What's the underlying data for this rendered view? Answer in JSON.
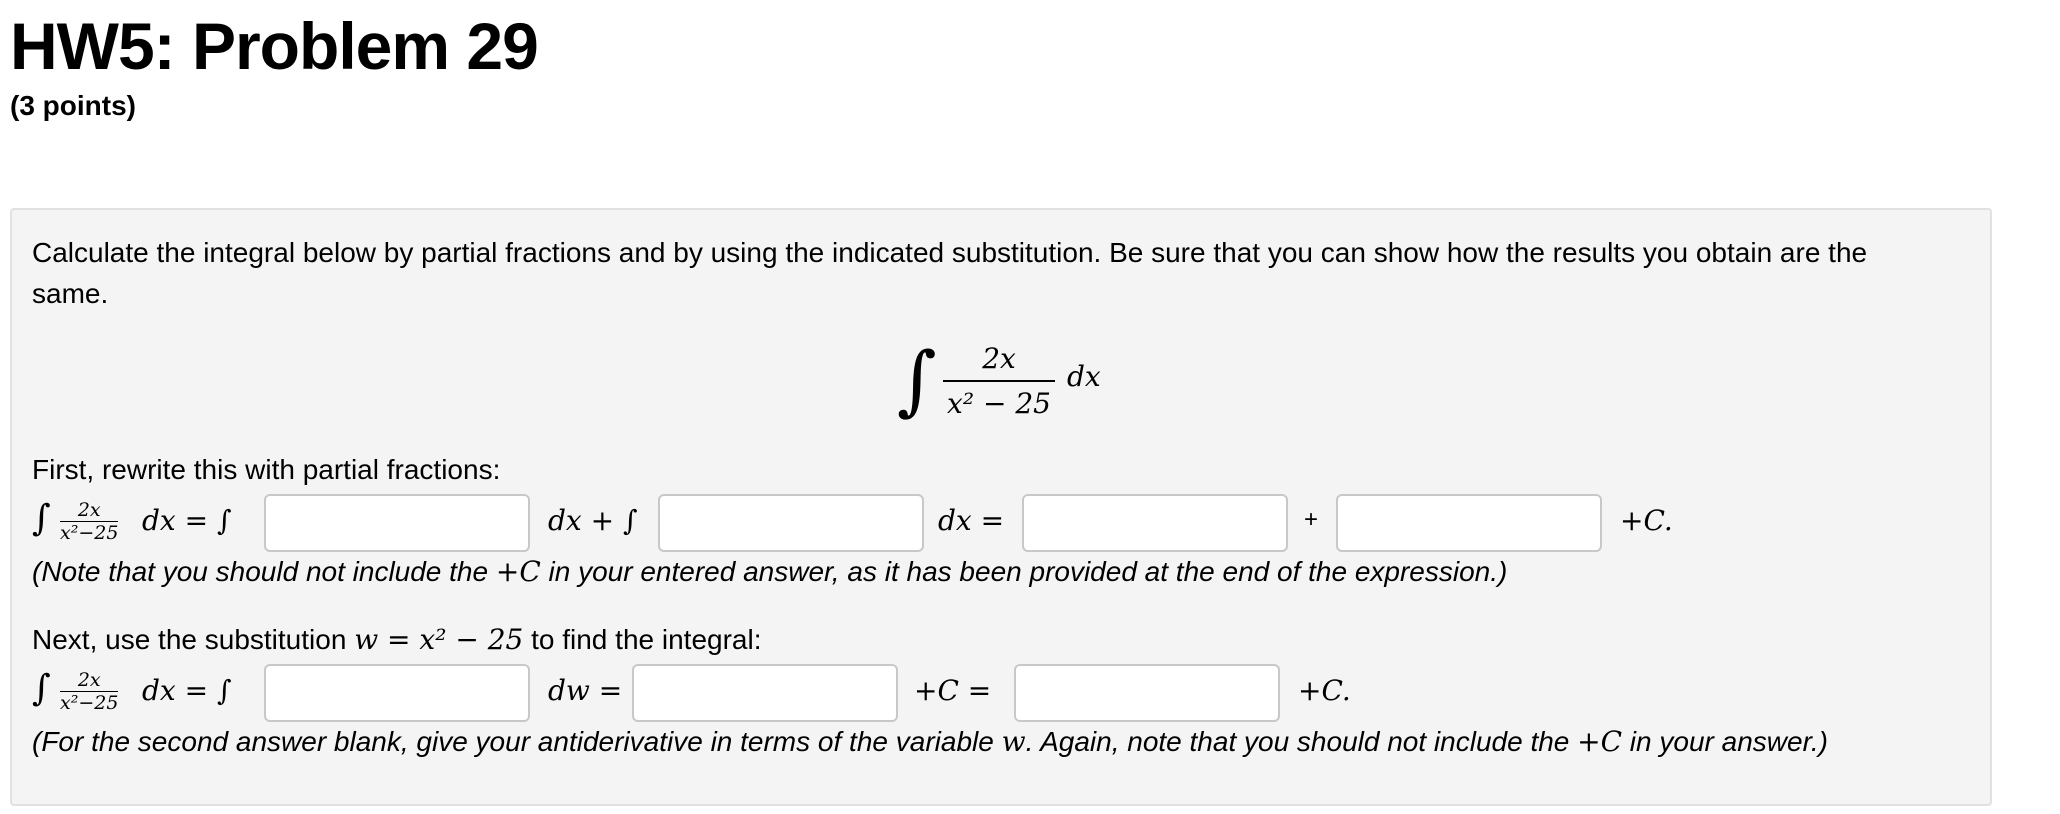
{
  "header": {
    "title": "HW5: Problem 29",
    "points": "(3 points)"
  },
  "problem": {
    "intro": "Calculate the integral below by partial fractions and by using the indicated substitution. Be sure that you can show how the results you obtain are the same.",
    "integrand_numerator": "2x",
    "integrand_denominator": "x² − 25",
    "differential": "dx",
    "part1": {
      "prompt": "First, rewrite this with partial fractions:",
      "lhs_integral": "∫",
      "small_numerator": "2x",
      "small_denominator": "x²−25",
      "lhs_tail": "dx = ∫",
      "dx_plus_int": "dx + ∫",
      "dx_eq": "dx =",
      "plus": "+",
      "plus_c": "+C.",
      "answers": [
        "",
        "",
        "",
        ""
      ],
      "note_prefix": "(Note that you should not include the ",
      "note_c": "+C",
      "note_suffix": " in your entered answer, as it has been provided at the end of the expression.)"
    },
    "part2": {
      "prompt_prefix": "Next, use the substitution ",
      "prompt_math": "w = x² − 25",
      "prompt_suffix": " to find the integral:",
      "lhs_integral": "∫",
      "small_numerator": "2x",
      "small_denominator": "x²−25",
      "lhs_tail": "dx = ∫",
      "dw_eq": "dw =",
      "plus_c_eq": "+C =",
      "plus_c": "+C.",
      "answers": [
        "",
        "",
        ""
      ],
      "note_prefix": "(For the second answer blank, give your antiderivative in terms of the variable ",
      "note_w": "w",
      "note_middle": ". Again, note that you should not include the ",
      "note_c": "+C",
      "note_suffix": " in your answer.)"
    }
  }
}
